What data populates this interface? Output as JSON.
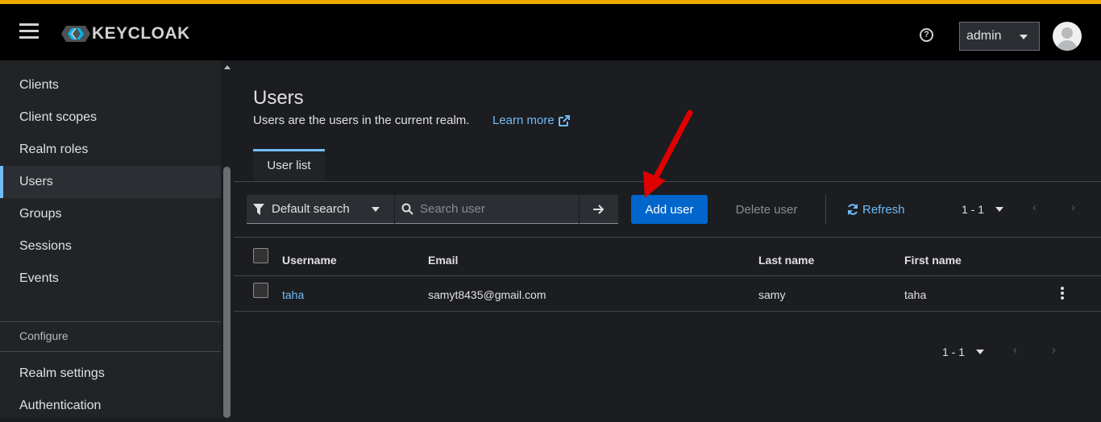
{
  "topbar": {
    "logo_text": "KEYCLOAK",
    "help_label": "?",
    "user_menu_label": "admin",
    "accent_color": "#f0ab00"
  },
  "sidebar": {
    "items": [
      {
        "label": "Clients",
        "active": false
      },
      {
        "label": "Client scopes",
        "active": false
      },
      {
        "label": "Realm roles",
        "active": false
      },
      {
        "label": "Users",
        "active": true
      },
      {
        "label": "Groups",
        "active": false
      },
      {
        "label": "Sessions",
        "active": false
      },
      {
        "label": "Events",
        "active": false
      }
    ],
    "section_configure": "Configure",
    "configure_items": [
      {
        "label": "Realm settings"
      },
      {
        "label": "Authentication"
      }
    ]
  },
  "main": {
    "title": "Users",
    "description": "Users are the users in the current realm.",
    "learn_more": "Learn more",
    "tabs": [
      {
        "label": "User list",
        "active": true
      }
    ],
    "toolbar": {
      "search_type": "Default search",
      "search_placeholder": "Search user",
      "add_user": "Add user",
      "delete_user": "Delete user",
      "refresh": "Refresh",
      "pagination_top": "1 - 1"
    },
    "table": {
      "columns": [
        "Username",
        "Email",
        "Last name",
        "First name"
      ],
      "rows": [
        {
          "username": "taha",
          "email": "samyt8435@gmail.com",
          "last_name": "samy",
          "first_name": "taha"
        }
      ]
    },
    "pagination_bottom": "1 - 1"
  }
}
